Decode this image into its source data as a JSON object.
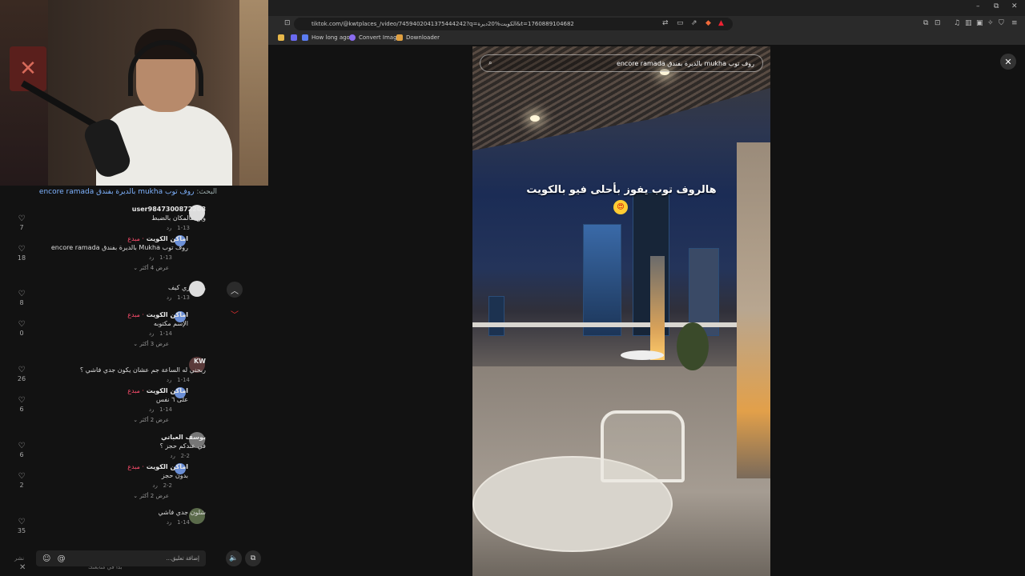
{
  "search_hint": {
    "prefix": "البحث:",
    "query": "روف توب mukha بالديرة بفندق encore ramada"
  },
  "comments": [
    {
      "user": "user9847300872208",
      "text": "وين هالمكان بالضبط",
      "date": "1-13",
      "reply": "رد",
      "likes": "7"
    },
    {
      "user": "اماكن الكويت",
      "tag": "· مبدع",
      "text": "روف توب Mukha بالديرة بفندق encore ramada",
      "date": "1-13",
      "reply": "رد",
      "likes": "18",
      "more": "عرض 4 أكثر"
    },
    {
      "user": "",
      "text": "واسماري كيف",
      "date": "1-13",
      "reply": "رد",
      "likes": "8"
    },
    {
      "user": "اماكن الكويت",
      "tag": "· مبدع",
      "text": "الإسم مكتوبه",
      "date": "1-14",
      "reply": "رد",
      "likes": "0",
      "more": "عرض 3 أكثر"
    },
    {
      "user": "KW",
      "text": "ربحني له الساعة جم عشان يكون جدي فاشي ؟",
      "date": "1-14",
      "reply": "رد",
      "likes": "26"
    },
    {
      "user": "اماكن الكويت",
      "tag": "· مبدع",
      "text": "على ٦ نفس",
      "date": "1-14",
      "reply": "رد",
      "likes": "6",
      "more": "عرض 2 أكثر"
    },
    {
      "user": "يوسف العباتي",
      "text": "في عندكم حجز ؟",
      "date": "2-2",
      "reply": "رد",
      "likes": "6"
    },
    {
      "user": "اماكن الكويت",
      "tag": "· مبدع",
      "text": "بدون حجز",
      "date": "2-2",
      "reply": "رد",
      "likes": "2",
      "more": "عرض 2 أكثر"
    },
    {
      "user": "",
      "text": "شلون جدي فاشي",
      "date": "1-14",
      "reply": "رد",
      "likes": "35"
    }
  ],
  "comment_input": {
    "placeholder": "إضافة تعليق...",
    "mention": "@",
    "emoji": "☺"
  },
  "footer": {
    "label": "نشر",
    "text": "بدأ في متابعتك"
  },
  "browser": {
    "url": "tiktok.com/@kwtplaces_/video/7459402041375444242?q=الكويت%20ديرة&t=1760889104682",
    "bookmarks": [
      {
        "label": "How long ago",
        "color": "#5b7cf0"
      },
      {
        "label": "Convert Image",
        "color": "#8a6cf0"
      },
      {
        "label": "Downloader",
        "color": "#e0a040"
      }
    ]
  },
  "video": {
    "search_query": "روف توب mukha بالديرة بفندق encore ramada",
    "caption": "هالروف توب يفوز بأحلى فيو بالكويت",
    "emoji": "😍"
  }
}
